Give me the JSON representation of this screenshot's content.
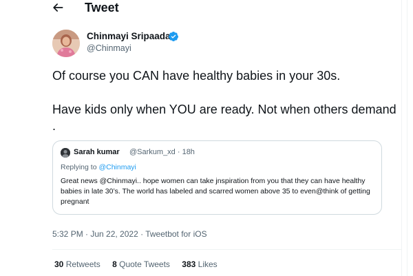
{
  "header": {
    "title": "Tweet",
    "back_icon": "arrow-left-icon"
  },
  "author": {
    "name": "Chinmayi Sripaada",
    "handle": "@Chinmayi",
    "verified_icon": "verified-badge-icon",
    "verified_color": "#1d9bf0"
  },
  "tweet": {
    "line1": "Of course you CAN have healthy babies in your 30s.",
    "line2": "Have kids only when YOU are ready. Not when others demand ."
  },
  "quote": {
    "name": "Sarah kumar",
    "meta": "@Sarkum_xd · 18h",
    "replying_prefix": "Replying to ",
    "replying_handle": "@Chinmayi",
    "body": "Great news @Chinmayi.. hope women can take jnspiration from you that they can have healthy babies in late 30’s. The world has labeled and scarred women above 35 to even@think of getting pregnant"
  },
  "timestamp": "5:32 PM · Jun 22, 2022 · Tweetbot for iOS",
  "stats": {
    "retweets_count": "30",
    "retweets_label": "Retweets",
    "quotes_count": "8",
    "quotes_label": "Quote Tweets",
    "likes_count": "383",
    "likes_label": "Likes"
  },
  "colors": {
    "link": "#1d9bf0",
    "muted": "#536471",
    "text": "#0f1419",
    "border": "#cfd9de"
  }
}
